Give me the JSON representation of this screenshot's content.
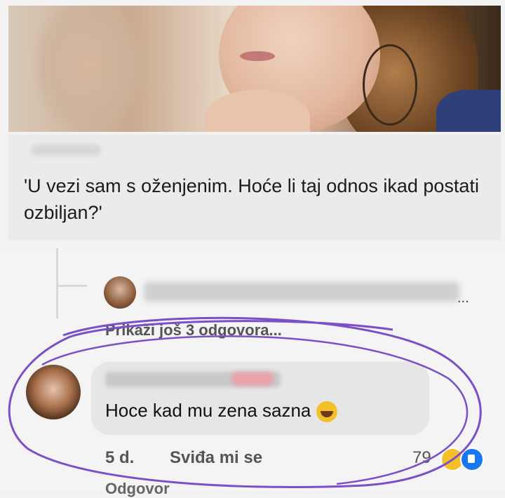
{
  "post": {
    "question": "'U vezi sam s oženjenim. Hoće li taj odnos ikad postati ozbiljan?'"
  },
  "thread": {
    "more_replies": "Prikaži još 3 odgovora...",
    "ellipsis": "..."
  },
  "comment": {
    "text": "Hoce kad mu zena sazna",
    "emoji": "laughing-tears-icon",
    "time": "5 d.",
    "like_label": "Sviđa mi se",
    "reaction_count": "79",
    "reply_label": "Odgovor"
  },
  "colors": {
    "annotation_circle": "#7b4fc9",
    "like_blue": "#1877f2",
    "haha_yellow": "#f4c02a"
  }
}
